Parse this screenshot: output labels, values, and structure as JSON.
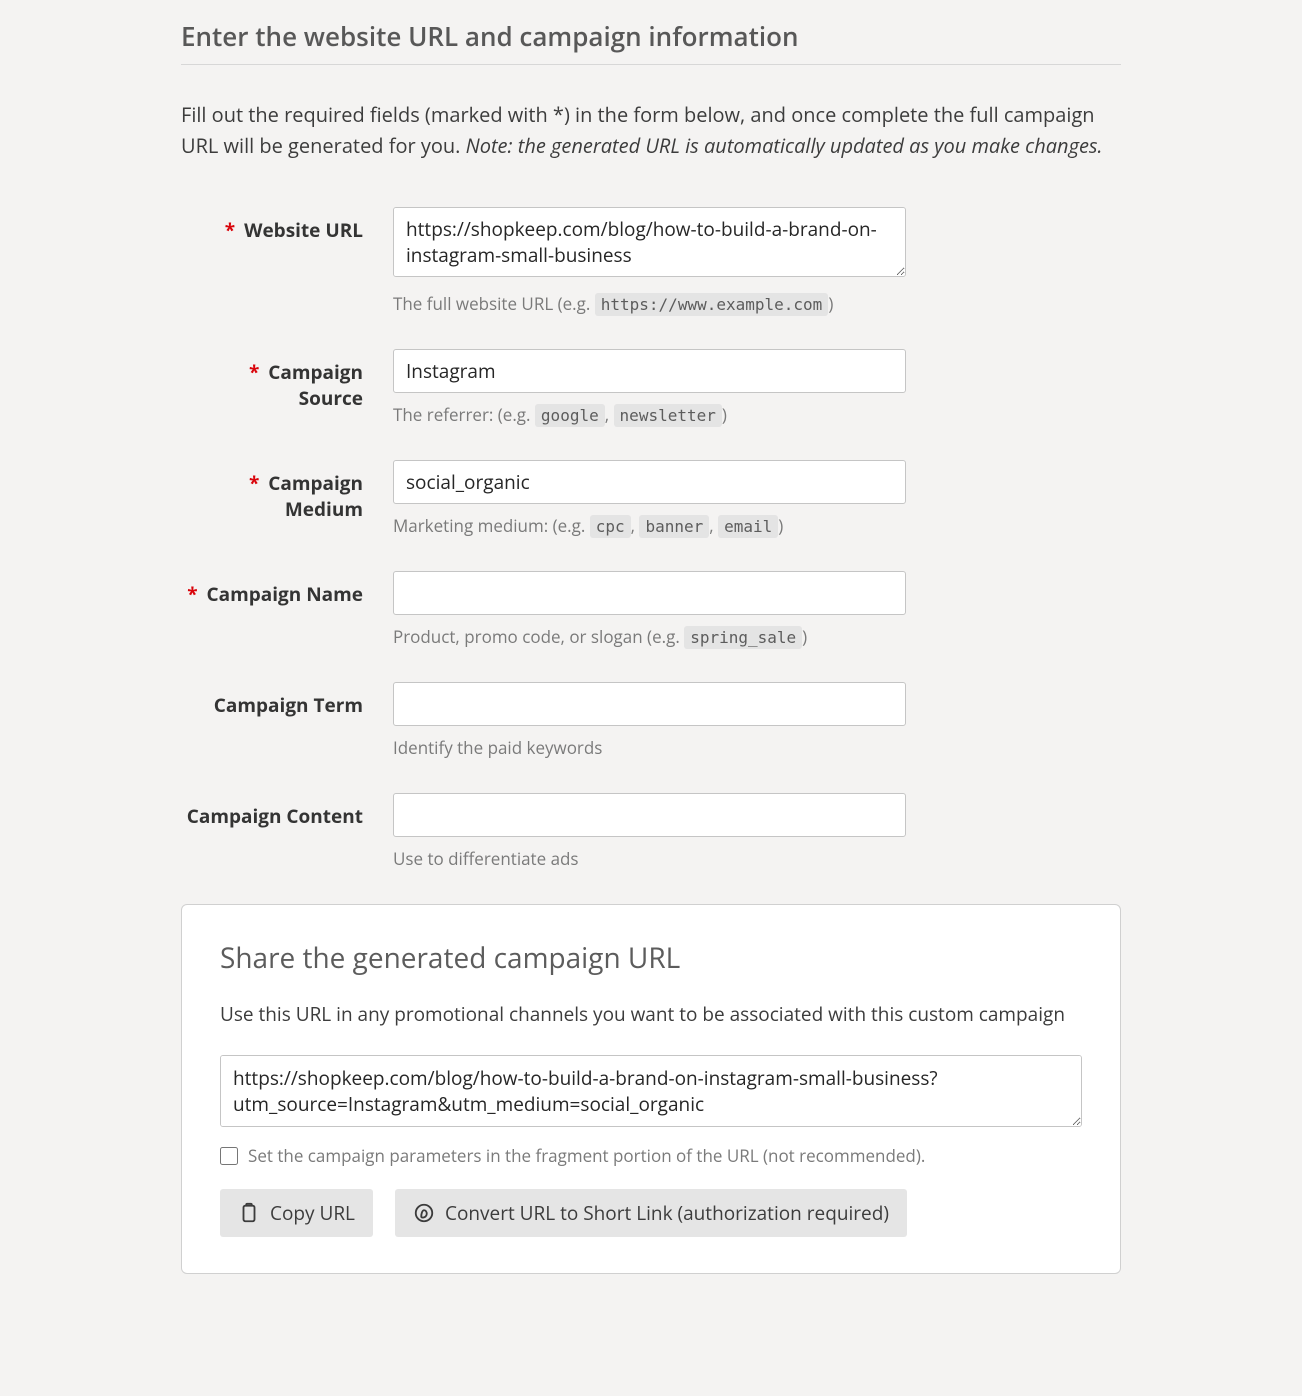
{
  "header": {
    "title": "Enter the website URL and campaign information"
  },
  "intro": {
    "text": "Fill out the required fields (marked with *) in the form below, and once complete the full campaign URL will be generated for you. ",
    "note": "Note: the generated URL is automatically updated as you make changes."
  },
  "fields": {
    "website_url": {
      "label": "Website URL",
      "required": true,
      "value": "https://shopkeep.com/blog/how-to-build-a-brand-on-instagram-small-business",
      "hint_pre": "The full website URL (e.g. ",
      "hint_code1": "https://www.example.com",
      "hint_post": ")"
    },
    "campaign_source": {
      "label": "Campaign Source",
      "required": true,
      "value": "Instagram",
      "hint_pre": "The referrer: (e.g. ",
      "hint_code1": "google",
      "hint_sep": ", ",
      "hint_code2": "newsletter",
      "hint_post": ")"
    },
    "campaign_medium": {
      "label": "Campaign Medium",
      "required": true,
      "value": "social_organic",
      "hint_pre": "Marketing medium: (e.g. ",
      "hint_code1": "cpc",
      "hint_sep": ", ",
      "hint_code2": "banner",
      "hint_sep2": ", ",
      "hint_code3": "email",
      "hint_post": ")"
    },
    "campaign_name": {
      "label": "Campaign Name",
      "required": true,
      "value": "",
      "hint_pre": "Product, promo code, or slogan (e.g. ",
      "hint_code1": "spring_sale",
      "hint_post": ")"
    },
    "campaign_term": {
      "label": "Campaign Term",
      "required": false,
      "value": "",
      "hint": "Identify the paid keywords"
    },
    "campaign_content": {
      "label": "Campaign Content",
      "required": false,
      "value": "",
      "hint": "Use to differentiate ads"
    }
  },
  "share": {
    "heading": "Share the generated campaign URL",
    "sub": "Use this URL in any promotional channels you want to be associated with this custom campaign",
    "generated_url": "https://shopkeep.com/blog/how-to-build-a-brand-on-instagram-small-business?utm_source=Instagram&utm_medium=social_organic",
    "fragment_checkbox_label": "Set the campaign parameters in the fragment portion of the URL (not recommended).",
    "copy_label": "Copy URL",
    "shorten_label": "Convert URL to Short Link (authorization required)"
  }
}
